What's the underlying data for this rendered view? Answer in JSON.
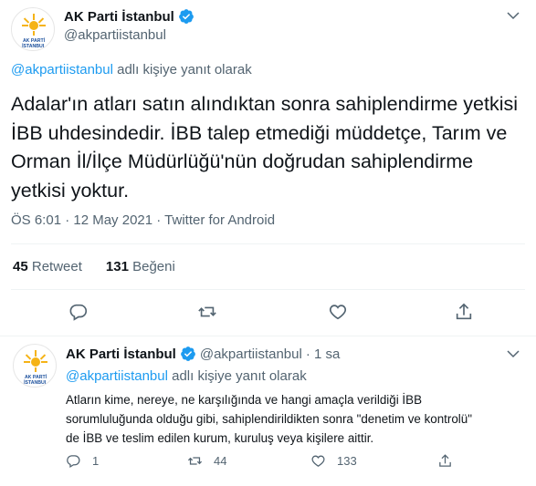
{
  "main_tweet": {
    "author_name": "AK Parti İstanbul",
    "author_handle": "@akpartiistanbul",
    "replying_to_handle": "@akpartiistanbul",
    "replying_to_suffix": "adlı kişiye yanıt olarak",
    "text": "Adalar'ın atları satın alındıktan sonra sahiplendirme yetkisi İBB uhdesindedir. İBB talep etmediği müddetçe, Tarım ve Orman İl/İlçe Müdürlüğü'nün doğrudan sahiplendirme yetkisi yoktur.",
    "timestamp": "ÖS 6:01 · 12 May 2021 · Twitter for Android",
    "retweet_count": "45",
    "retweet_label": "Retweet",
    "like_count": "131",
    "like_label": "Beğeni"
  },
  "reply_tweet": {
    "author_name": "AK Parti İstanbul",
    "author_handle": "@akpartiistanbul",
    "time": "· 1 sa",
    "replying_to_handle": "@akpartiistanbul",
    "replying_to_suffix": "adlı kişiye yanıt olarak",
    "text": "Atların kime, nereye, ne karşılığında ve hangi amaçla verildiği İBB sorumluluğunda olduğu gibi, sahiplendirildikten sonra \"denetim ve kontrolü\" de İBB ve teslim edilen kurum, kuruluş veya kişilere aittir.",
    "reply_count": "1",
    "retweet_count": "44",
    "like_count": "133"
  },
  "avatar_text": {
    "top": "AK PARTİ",
    "bottom": "İSTANBUL"
  },
  "colors": {
    "accent": "#1d9bf0",
    "secondary_text": "#536471",
    "logo_yellow": "#f5b316",
    "border": "#eff3f4"
  },
  "icons": [
    "verified-badge-icon",
    "chevron-down-icon",
    "reply-icon",
    "retweet-icon",
    "like-icon",
    "share-icon"
  ]
}
